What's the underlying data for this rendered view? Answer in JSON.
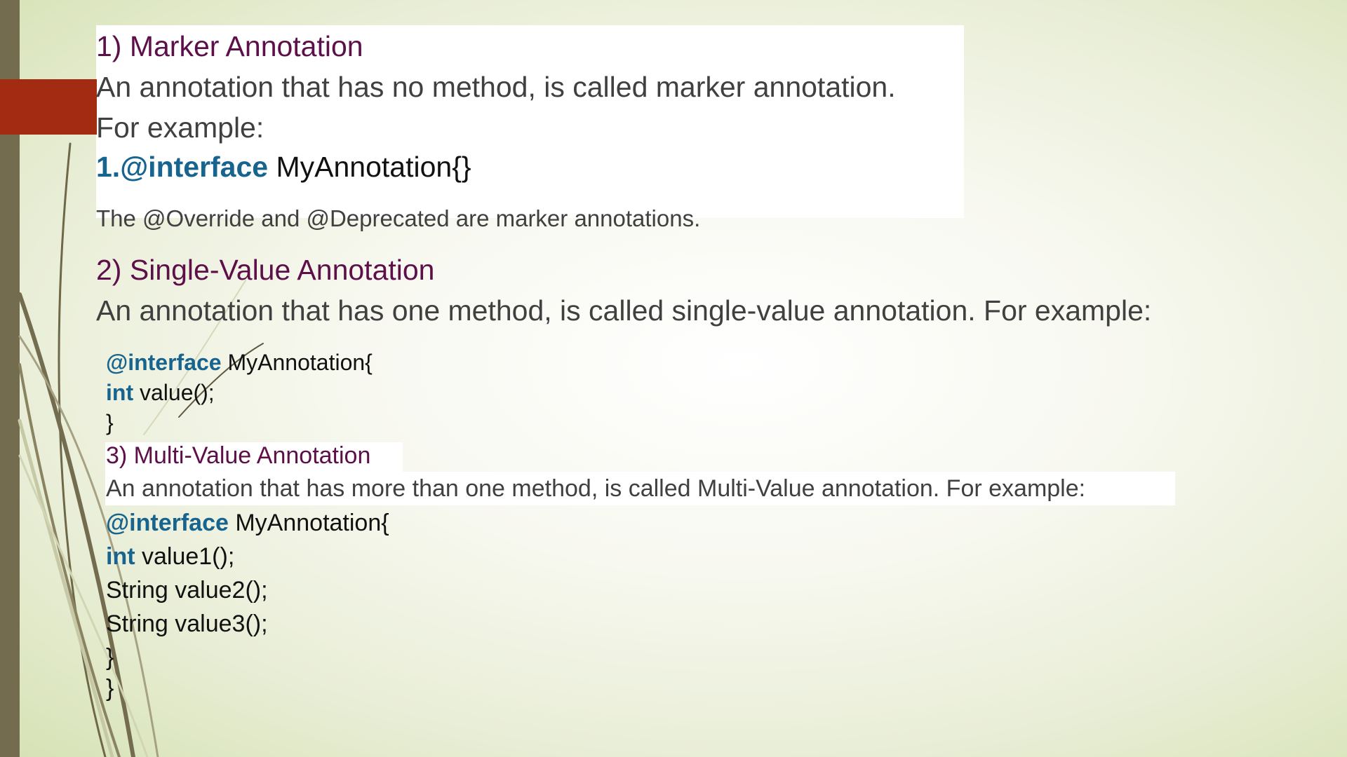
{
  "section1": {
    "heading": "1) Marker Annotation",
    "description": "An annotation that has no method, is called marker annotation.",
    "example_label": "For example:",
    "code_keyword": "1.@interface",
    "code_rest": " MyAnnotation{}",
    "note": "The @Override and @Deprecated are marker annotations."
  },
  "section2": {
    "heading": "2) Single-Value Annotation",
    "description": "An annotation that has one method, is called single-value annotation. For example:",
    "code": [
      {
        "kw": "@interface",
        "rest": " MyAnnotation{"
      },
      {
        "kw": "int",
        "rest": " value();"
      },
      {
        "kw": "",
        "rest": "}"
      }
    ]
  },
  "section3": {
    "heading": "3) Multi-Value Annotation",
    "description": "An annotation that has more than one method, is called Multi-Value annotation. For example:",
    "code": [
      {
        "kw": "@interface",
        "rest": " MyAnnotation{"
      },
      {
        "kw": "int",
        "rest": " value1();"
      },
      {
        "kw": "",
        "rest": "String value2();"
      },
      {
        "kw": "",
        "rest": "String value3();"
      },
      {
        "kw": "",
        "rest": "}"
      },
      {
        "kw": "",
        "rest": "}"
      }
    ]
  },
  "colors": {
    "heading": "#5d0f49",
    "keyword": "#17648f",
    "body_text": "#404040",
    "accent": "#a22b12",
    "side_bar": "#736c4f"
  }
}
